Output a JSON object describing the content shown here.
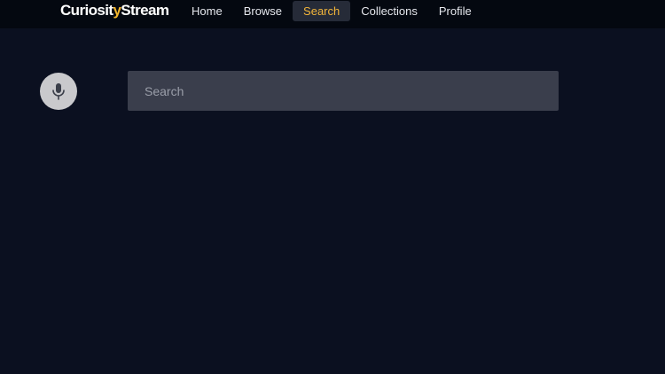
{
  "brand": {
    "logo_prefix": "Curiosit",
    "logo_accent": "y",
    "logo_suffix": "Stream",
    "accent_color": "#f3b52b"
  },
  "nav": {
    "items": [
      {
        "label": "Home",
        "active": false
      },
      {
        "label": "Browse",
        "active": false
      },
      {
        "label": "Search",
        "active": true
      },
      {
        "label": "Collections",
        "active": false
      },
      {
        "label": "Profile",
        "active": false
      }
    ],
    "active_color": "#f2b53a"
  },
  "voice": {
    "icon": "microphone-icon"
  },
  "search": {
    "placeholder": "Search",
    "value": ""
  },
  "colors": {
    "background": "#0b1020",
    "topbar": "#040810",
    "search_field": "#3a3e4c",
    "mic_button": "#c9c9cc"
  }
}
